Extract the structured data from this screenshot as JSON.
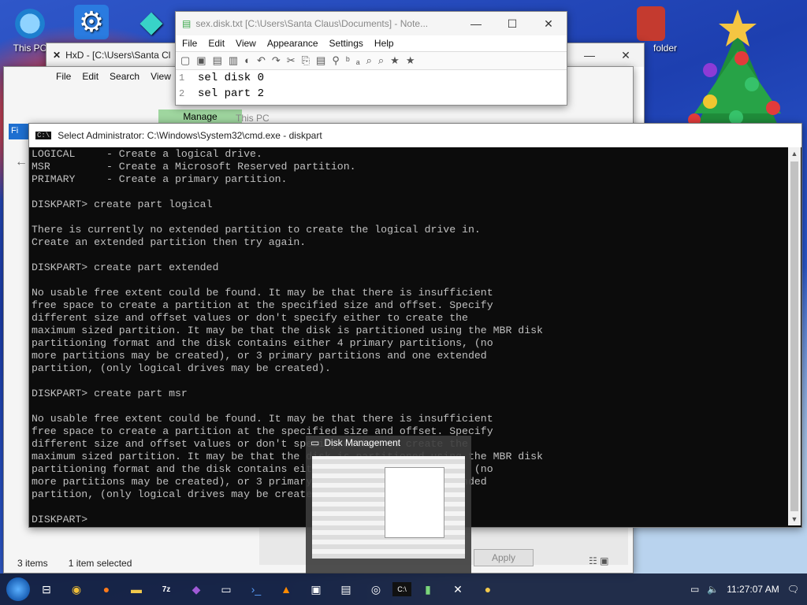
{
  "desktop_icons": [
    {
      "label": "This PC",
      "icon": "monitor-icon"
    },
    {
      "label": "",
      "icon": "gear-icon"
    },
    {
      "label": "",
      "icon": "diamond-icon"
    },
    {
      "label": "folder",
      "icon": "folder-icon"
    }
  ],
  "hxd": {
    "title": "HxD - [C:\\Users\\Santa Cl"
  },
  "notepad": {
    "title": "sex.disk.txt [C:\\Users\\Santa Claus\\Documents] - Note...",
    "menu": [
      "File",
      "Edit",
      "View",
      "Appearance",
      "Settings",
      "Help"
    ],
    "lines": [
      {
        "n": "1",
        "text": "sel disk 0"
      },
      {
        "n": "2",
        "text": "sel part 2"
      }
    ]
  },
  "explorer_back": {
    "menu": [
      "File",
      "Edit",
      "Search",
      "View"
    ],
    "ribbon_tab": "Manage",
    "ribbon_title": "This PC",
    "status_items": "3 items",
    "status_selected": "1 item selected",
    "apply_label": "Apply"
  },
  "cmd": {
    "title": "Select Administrator: C:\\Windows\\System32\\cmd.exe - diskpart",
    "text": "LOGICAL     - Create a logical drive.\nMSR         - Create a Microsoft Reserved partition.\nPRIMARY     - Create a primary partition.\n\nDISKPART> create part logical\n\nThere is currently no extended partition to create the logical drive in.\nCreate an extended partition then try again.\n\nDISKPART> create part extended\n\nNo usable free extent could be found. It may be that there is insufficient\nfree space to create a partition at the specified size and offset. Specify\ndifferent size and offset values or don't specify either to create the\nmaximum sized partition. It may be that the disk is partitioned using the MBR disk\npartitioning format and the disk contains either 4 primary partitions, (no\nmore partitions may be created), or 3 primary partitions and one extended\npartition, (only logical drives may be created).\n\nDISKPART> create part msr\n\nNo usable free extent could be found. It may be that there is insufficient\nfree space to create a partition at the specified size and offset. Specify\ndifferent size and offset values or don't specify either to create the\nmaximum sized partition. It may be that the disk is partitioned using the MBR disk\npartitioning format and the disk contains either 4 primary partitions, (no\nmore partitions may be created), or 3 primary partitions and one extended\npartition, (only logical drives may be created).\n\nDISKPART> "
  },
  "thumbnail": {
    "title": "Disk Management"
  },
  "taskbar": {
    "clock": "11:27:07 AM",
    "items": [
      "start",
      "task-view",
      "chrome",
      "firefox",
      "explorer",
      "7zip",
      "app",
      "notepad",
      "powershell",
      "vlc",
      "window",
      "disk",
      "browser",
      "cmd",
      "notepad++",
      "hxd",
      "paint"
    ]
  },
  "colors": {
    "console_bg": "#0c0c0c",
    "console_fg": "#c0c0c0",
    "desktop": "#2f57c9",
    "ribbon_manage": "#9fd69f"
  }
}
